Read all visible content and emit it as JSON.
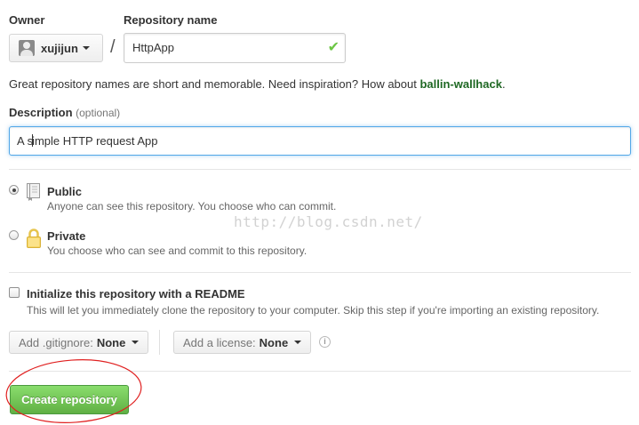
{
  "owner": {
    "label": "Owner",
    "name": "xujijun"
  },
  "repo": {
    "label": "Repository name",
    "value": "HttpApp",
    "separator": "/",
    "valid_icon": "checkmark-icon"
  },
  "hint": {
    "text": "Great repository names are short and memorable. Need inspiration? How about ",
    "suggestion": "ballin-wallhack",
    "end": "."
  },
  "description": {
    "label": "Description",
    "optional": "(optional)",
    "value_before": "A s",
    "value_after": "imple HTTP request App"
  },
  "visibility": {
    "public": {
      "title": "Public",
      "subtitle": "Anyone can see this repository. You choose who can commit.",
      "selected": true,
      "icon": "book-icon"
    },
    "private": {
      "title": "Private",
      "subtitle": "You choose who can see and commit to this repository.",
      "selected": false,
      "icon": "lock-icon"
    }
  },
  "readme": {
    "title": "Initialize this repository with a README",
    "subtitle": "This will let you immediately clone the repository to your computer. Skip this step if you're importing an existing repository.",
    "checked": false
  },
  "gitignore": {
    "label": "Add .gitignore:",
    "value": "None"
  },
  "license": {
    "label": "Add a license:",
    "value": "None"
  },
  "info": {
    "glyph": "i",
    "icon": "info-icon"
  },
  "create_button": "Create repository",
  "watermark": "http://blog.csdn.net/",
  "colors": {
    "accent": "#60b044",
    "focus": "#51a7e8",
    "annotation": "#e02020",
    "suggestion": "#1e6823"
  }
}
